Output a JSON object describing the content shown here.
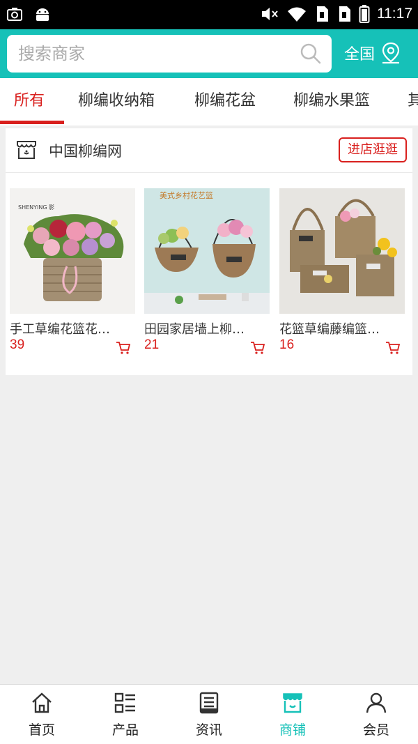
{
  "status_bar": {
    "time": "11:17"
  },
  "search": {
    "placeholder": "搜索商家",
    "region_label": "全国"
  },
  "tabs": [
    {
      "label": "所有",
      "active": true
    },
    {
      "label": "柳编收纳箱",
      "active": false
    },
    {
      "label": "柳编花盆",
      "active": false
    },
    {
      "label": "柳编水果篮",
      "active": false
    },
    {
      "label": "其",
      "active": false
    }
  ],
  "shop": {
    "name": "中国柳编网",
    "enter_label": "进店逛逛",
    "products": [
      {
        "title": "手工草编花篮花…",
        "price": "39"
      },
      {
        "title": "田园家居墙上柳…",
        "price": "21"
      },
      {
        "title": "花篮草编藤编篮…",
        "price": "16"
      }
    ],
    "image_texts": {
      "p1_brand": "SHENYING 影",
      "p2_caption": "美式乡村花艺篮"
    }
  },
  "bottom_nav": [
    {
      "label": "首页",
      "icon": "home-icon",
      "active": false
    },
    {
      "label": "产品",
      "icon": "list-icon",
      "active": false
    },
    {
      "label": "资讯",
      "icon": "news-icon",
      "active": false
    },
    {
      "label": "商铺",
      "icon": "shop-icon",
      "active": true
    },
    {
      "label": "会员",
      "icon": "user-icon",
      "active": false
    }
  ],
  "colors": {
    "primary": "#16c1b8",
    "accent_red": "#d9201e",
    "background": "#efefef"
  }
}
